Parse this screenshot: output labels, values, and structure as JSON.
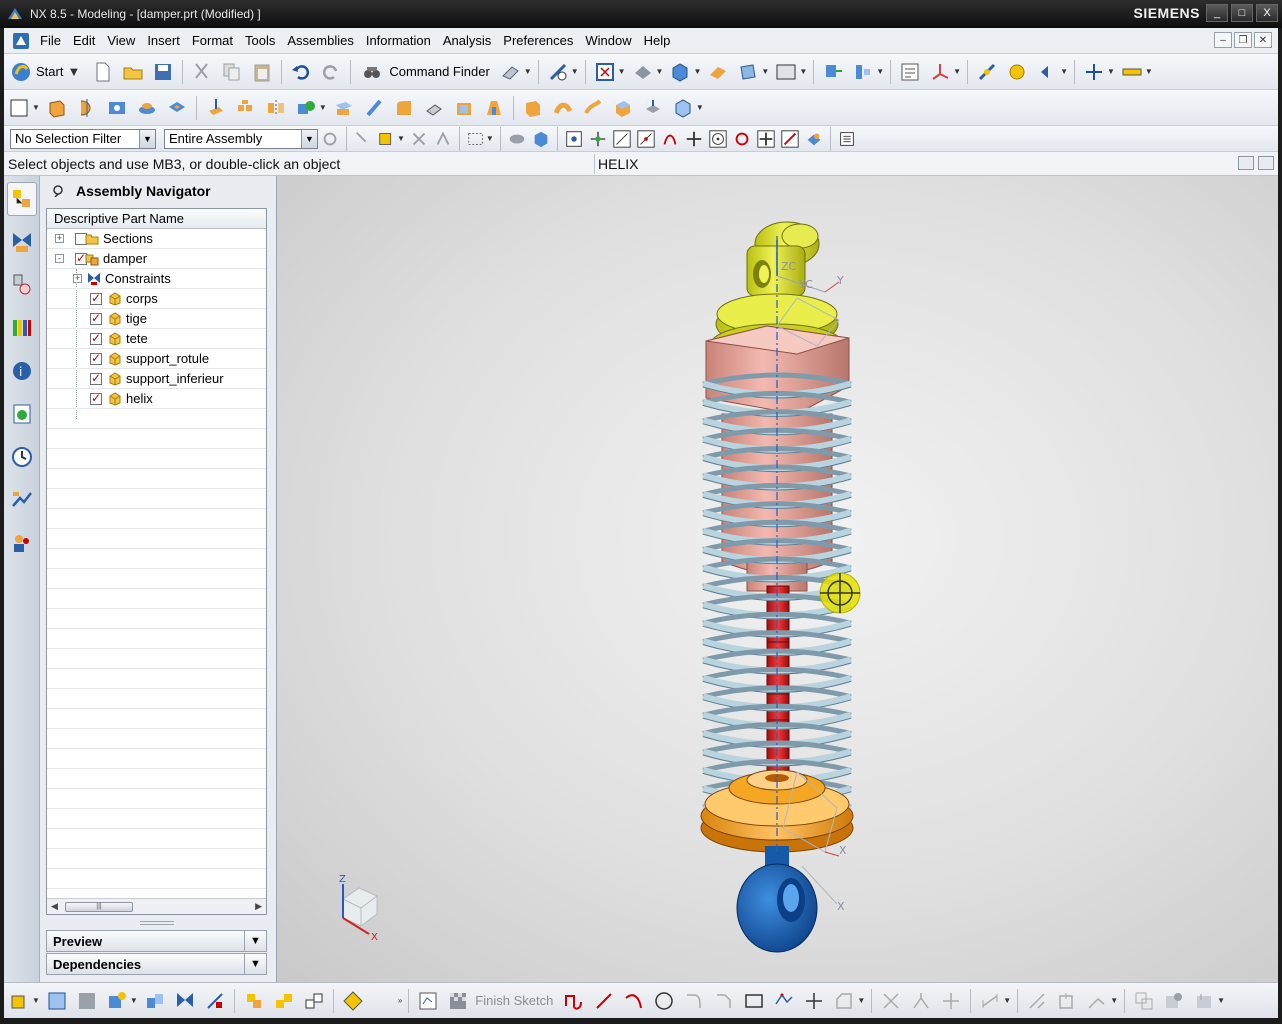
{
  "window": {
    "title": "NX 8.5 - Modeling - [damper.prt (Modified) ]",
    "brand": "SIEMENS",
    "controls": [
      "_",
      "□",
      "X"
    ]
  },
  "menubar": {
    "items": [
      "File",
      "Edit",
      "View",
      "Insert",
      "Format",
      "Tools",
      "Assemblies",
      "Information",
      "Analysis",
      "Preferences",
      "Window",
      "Help"
    ]
  },
  "toolbar": {
    "start_label": "Start",
    "command_finder_label": "Command Finder",
    "selection_filter": "No Selection Filter",
    "selection_scope": "Entire Assembly"
  },
  "cue_line": {
    "prompt": "Select objects and use MB3, or double-click an object",
    "status": "HELIX"
  },
  "navigator": {
    "title": "Assembly Navigator",
    "column_header": "Descriptive Part Name",
    "rows": [
      {
        "label": "Sections",
        "level": 0,
        "expander": "+",
        "checked": false,
        "icon": "folder-icon"
      },
      {
        "label": "damper",
        "level": 0,
        "expander": "-",
        "checked": true,
        "icon": "assembly-icon"
      },
      {
        "label": "Constraints",
        "level": 1,
        "expander": "+",
        "checked": null,
        "icon": "constraints-icon"
      },
      {
        "label": "corps",
        "level": 2,
        "expander": null,
        "checked": true,
        "icon": "part-icon"
      },
      {
        "label": "tige",
        "level": 2,
        "expander": null,
        "checked": true,
        "icon": "part-icon"
      },
      {
        "label": "tete",
        "level": 2,
        "expander": null,
        "checked": true,
        "icon": "part-icon"
      },
      {
        "label": "support_rotule",
        "level": 2,
        "expander": null,
        "checked": true,
        "icon": "part-icon"
      },
      {
        "label": "support_inferieur",
        "level": 2,
        "expander": null,
        "checked": true,
        "icon": "part-icon"
      },
      {
        "label": "helix",
        "level": 2,
        "expander": null,
        "checked": true,
        "icon": "part-icon"
      }
    ],
    "preview_label": "Preview",
    "dependencies_label": "Dependencies"
  },
  "graphics": {
    "triad_labels": {
      "z": "Z",
      "x": "X"
    },
    "csys_labels": {
      "zc": "ZC",
      "yc": "YC",
      "y": "Y",
      "x": "X"
    }
  },
  "bottom_toolbar": {
    "finish_sketch_label": "Finish Sketch"
  },
  "colors": {
    "head": "#d9e021",
    "body": "#e9a39a",
    "spring": "#a9c7d6",
    "rod": "#d81f1f",
    "lower_support": "#f5a623",
    "eye": "#1565c0"
  }
}
